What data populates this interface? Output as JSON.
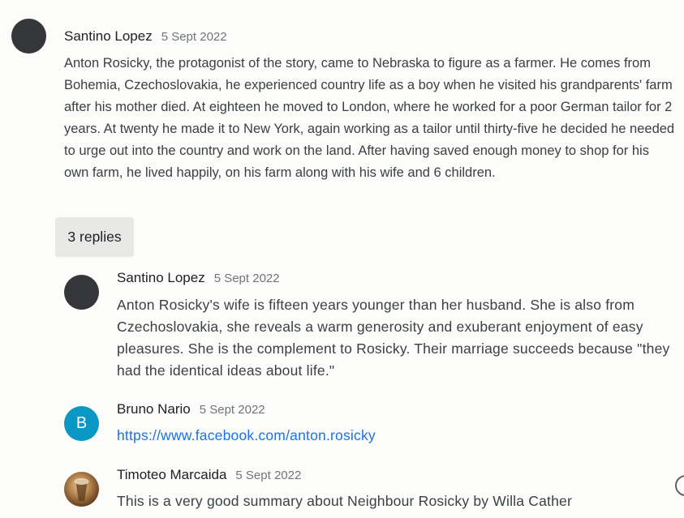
{
  "main_comment": {
    "author": "Santino Lopez",
    "date": "5 Sept 2022",
    "text": "Anton Rosicky, the protagonist of the story, came to Nebraska to figure as a farmer. He comes from Bohemia, Czechoslovakia, he experienced country life as a boy when he visited his grandparents' farm after his mother died. At eighteen he moved to London, where he worked for a poor German tailor for 2 years. At twenty he made it to New York, again working as a tailor until thirty-five he decided he needed to urge out into the country and work on the land. After having saved enough money to shop for his own farm, he lived happily, on his farm along with his wife and 6 children."
  },
  "replies_toggle_label": "3 replies",
  "replies": [
    {
      "author": "Santino Lopez",
      "date": "5 Sept 2022",
      "text": "Anton Rosicky's wife is fifteen years younger than her husband. She is also from Czechoslovakia, she reveals a warm generosity and exuberant enjoyment of easy pleasures. She is the complement to Rosicky. Their marriage succeeds because \"they had the identical ideas about life.\""
    },
    {
      "author": "Bruno Nario",
      "avatar_letter": "B",
      "date": "5 Sept 2022",
      "link": "https://www.facebook.com/anton.rosicky"
    },
    {
      "author": "Timoteo Marcaida",
      "date": "5 Sept 2022",
      "text": "This is a very good summary about Neighbour Rosicky by Willa Cather"
    }
  ],
  "colors": {
    "background": "#fcfcfa",
    "avatar_dark": "#35363a",
    "avatar_letter_bg": "#0b97c4",
    "link": "#1a73e8",
    "replies_button_bg": "#e8e8e6"
  },
  "icons": {
    "help": "help-icon"
  }
}
